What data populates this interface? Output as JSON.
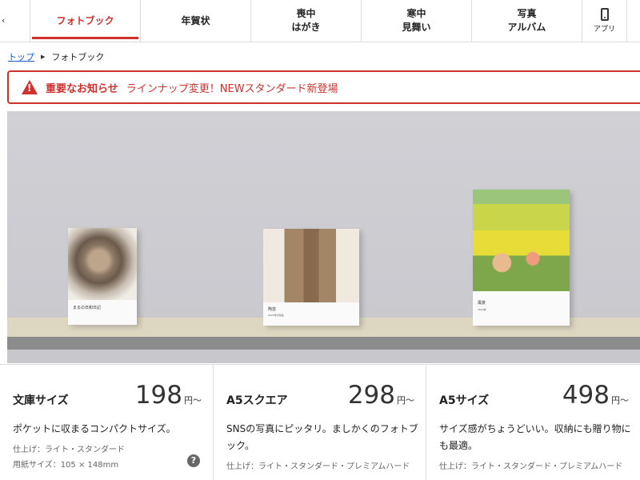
{
  "nav": {
    "items": [
      {
        "line1": "フォトブック",
        "line2": ""
      },
      {
        "line1": "年賀状",
        "line2": ""
      },
      {
        "line1": "喪中",
        "line2": "はがき"
      },
      {
        "line1": "寒中",
        "line2": "見舞い"
      },
      {
        "line1": "写真",
        "line2": "アルバム"
      }
    ],
    "app_label": "アプリ"
  },
  "breadcrumb": {
    "home": "トップ",
    "current": "フォトブック"
  },
  "notice": {
    "label": "重要なお知らせ",
    "message": "ラインナップ変更！NEWスタンダード新登場"
  },
  "hero": {
    "books": [
      {
        "caption": "まるの日和日記",
        "sub": ""
      },
      {
        "caption": "陶芸",
        "sub": "2023年の作品"
      },
      {
        "caption": "風景",
        "sub": "2023春"
      }
    ]
  },
  "products": [
    {
      "name": "文庫サイズ",
      "price": "198",
      "unit": "円〜",
      "description": "ポケットに収まるコンパクトサイズ。",
      "finish": "仕上げ：ライト・スタンダード",
      "paper": "用紙サイズ：105 × 148mm"
    },
    {
      "name": "A5スクエア",
      "price": "298",
      "unit": "円〜",
      "description": "SNSの写真にピッタリ。ましかくのフォトブック。",
      "finish": "仕上げ：ライト・スタンダード・プレミアムハード"
    },
    {
      "name": "A5サイズ",
      "price": "498",
      "unit": "円〜",
      "description": "サイズ感がちょうどいい。収納にも贈り物にも最適。",
      "finish": "仕上げ：ライト・スタンダード・プレミアムハード"
    }
  ],
  "colors": {
    "accent": "#d0312d",
    "link": "#1a5fbf"
  }
}
